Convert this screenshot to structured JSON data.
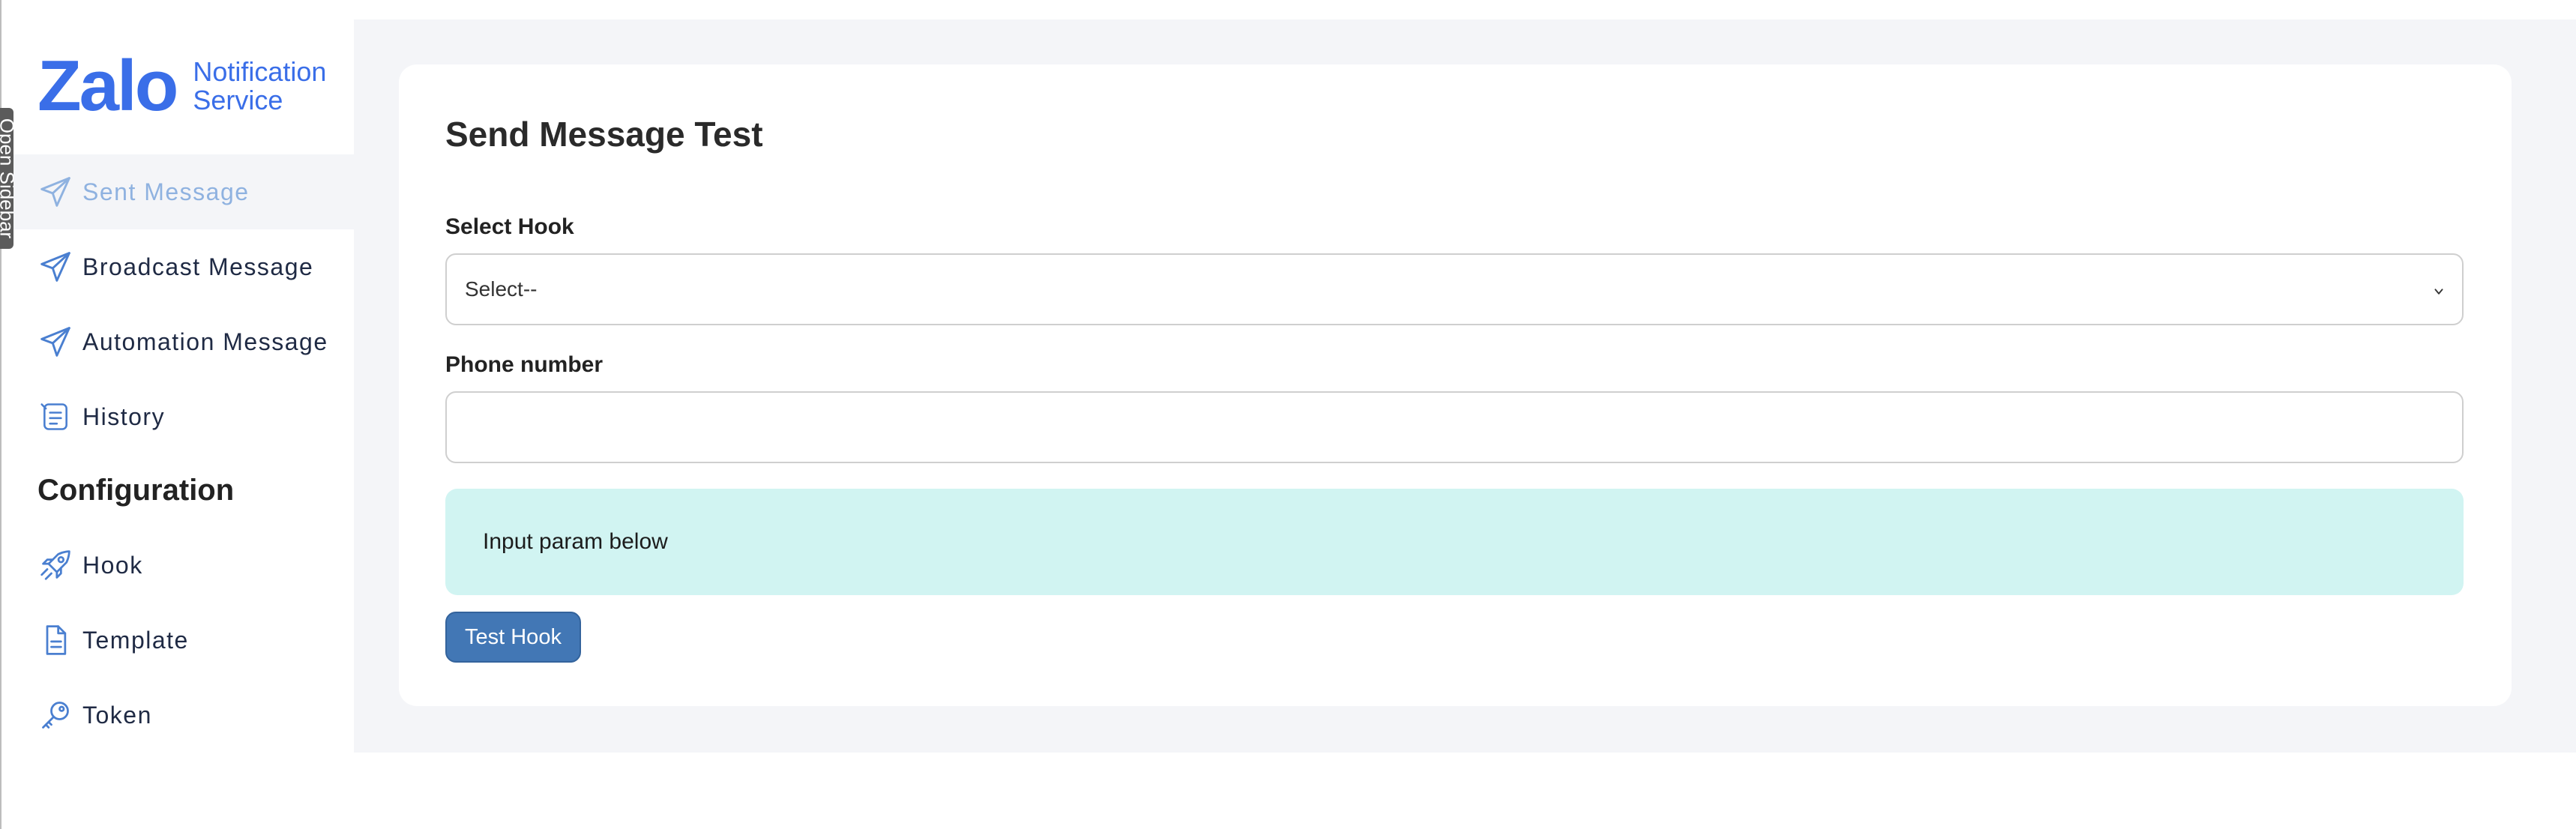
{
  "open_sidebar_label": "Open Sidebar",
  "brand": {
    "logo_text": "Zalo",
    "subtitle_line1": "Notification",
    "subtitle_line2": "Service",
    "color": "#3a6ee8"
  },
  "nav": [
    {
      "label": "Sent Message",
      "icon": "send-icon",
      "active": true
    },
    {
      "label": "Broadcast Message",
      "icon": "send-icon",
      "active": false
    },
    {
      "label": "Automation Message",
      "icon": "send-icon",
      "active": false
    },
    {
      "label": "History",
      "icon": "history-icon",
      "active": false
    }
  ],
  "config_heading": "Configuration",
  "config_nav": [
    {
      "label": "Hook",
      "icon": "rocket-icon"
    },
    {
      "label": "Template",
      "icon": "document-icon"
    },
    {
      "label": "Token",
      "icon": "key-icon"
    }
  ],
  "page": {
    "title": "Send Message Test",
    "select_hook_label": "Select Hook",
    "select_hook_value": "Select--",
    "phone_label": "Phone number",
    "phone_value": "",
    "info_text": "Input param below",
    "button_label": "Test Hook"
  },
  "colors": {
    "accent": "#3a6ee8",
    "active_nav_text": "#8fb2e0",
    "info_bg": "#d1f4f2",
    "button_bg": "#4277b5",
    "main_bg": "#f4f5f8"
  }
}
